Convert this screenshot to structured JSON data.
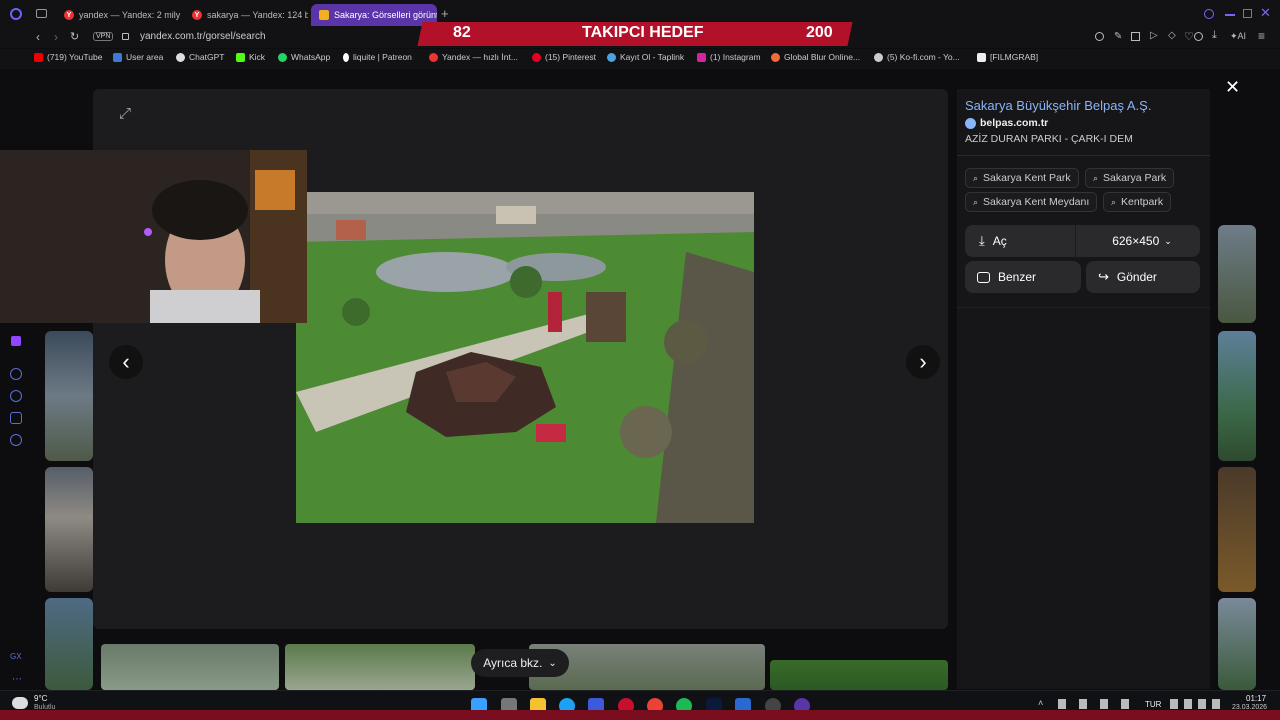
{
  "tabs": [
    {
      "label": "yandex — Yandex: 2 milyo",
      "active": false
    },
    {
      "label": "sakarya — Yandex: 124 bi",
      "active": false
    },
    {
      "label": "Sakarya: Görselleri görünt",
      "active": true
    }
  ],
  "address": {
    "url": "yandex.com.tr/gorsel/search",
    "vpn": "VPN"
  },
  "bookmarks": [
    "(719) YouTube",
    "User area",
    "ChatGPT",
    "Kick",
    "WhatsApp",
    "liquite | Patreon",
    "Yandex — hızlı İnt...",
    "(15) Pinterest",
    "Kayıt Ol - Taplink",
    "(1) Instagram",
    "Global Blur Online...",
    "(5) Ko-fi.com - Yo...",
    "[FILMGRAB]"
  ],
  "overlay": {
    "left_count": "82",
    "title": "TAKIPCI HEDEF",
    "right_count": "200"
  },
  "panel": {
    "source_title": "Sakarya Büyükşehir Belpaş A.Ş.",
    "domain": "belpas.com.tr",
    "caption": "AZİZ DURAN PARKI - ÇARK-I DEM",
    "chips": [
      "Sakarya Kent Park",
      "Sakarya Park",
      "Sakarya Kent Meydanı",
      "Kentpark"
    ],
    "open_label": "Aç",
    "size_label": "626×450",
    "similar_label": "Benzer",
    "share_label": "Gönder"
  },
  "bottom": {
    "also_label": "Ayrıca bkz."
  },
  "taskbar": {
    "weather": "9°C",
    "weather_desc": "Bulutlu",
    "lang": "TUR",
    "time": "01:17",
    "date": "23.03.2026"
  },
  "colors": {
    "overlay_red": "#b3112a",
    "active_tab": "#5a35a8",
    "link_blue": "#8ab4f8"
  }
}
